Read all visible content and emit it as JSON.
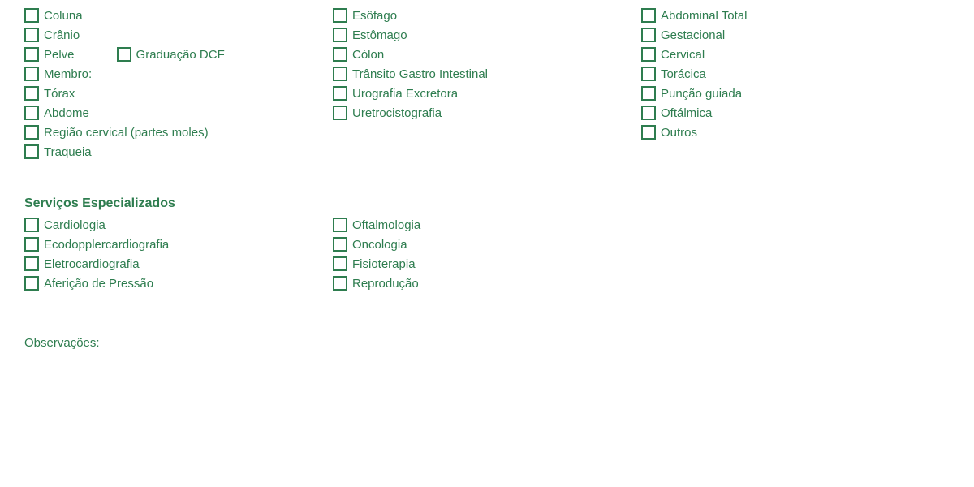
{
  "col1": {
    "items": [
      {
        "label": "Coluna"
      },
      {
        "label": "Crânio"
      },
      {
        "label": "Pelve",
        "has_graduacao": true
      },
      {
        "label": "Membro:",
        "has_underline": true
      },
      {
        "label": "Tórax"
      },
      {
        "label": "Abdome"
      },
      {
        "label": "Região cervical (partes moles)"
      },
      {
        "label": "Traqueia"
      }
    ],
    "graduacao_label": "Graduação DCF"
  },
  "col2": {
    "items": [
      {
        "label": "Esôfago"
      },
      {
        "label": "Estômago"
      },
      {
        "label": "Cólon"
      },
      {
        "label": "Trânsito Gastro Intestinal"
      },
      {
        "label": "Urografia Excretora"
      },
      {
        "label": "Uretrocistografia"
      }
    ]
  },
  "col3": {
    "items": [
      {
        "label": "Abdominal Total"
      },
      {
        "label": "Gestacional"
      },
      {
        "label": "Cervical"
      },
      {
        "label": "Torácica"
      },
      {
        "label": "Punção guiada"
      },
      {
        "label": "Oftálmica"
      },
      {
        "label": "Outros"
      }
    ]
  },
  "servicos": {
    "title": "Serviços Especializados",
    "col1": [
      {
        "label": "Cardiologia"
      },
      {
        "label": "Ecodopplercardiografia"
      },
      {
        "label": "Eletrocardiografia"
      },
      {
        "label": "Aferição de Pressão"
      }
    ],
    "col2": [
      {
        "label": "Oftalmologia"
      },
      {
        "label": "Oncologia"
      },
      {
        "label": "Fisioterapia"
      },
      {
        "label": "Reprodução"
      }
    ]
  },
  "observacoes_label": "Observações:"
}
